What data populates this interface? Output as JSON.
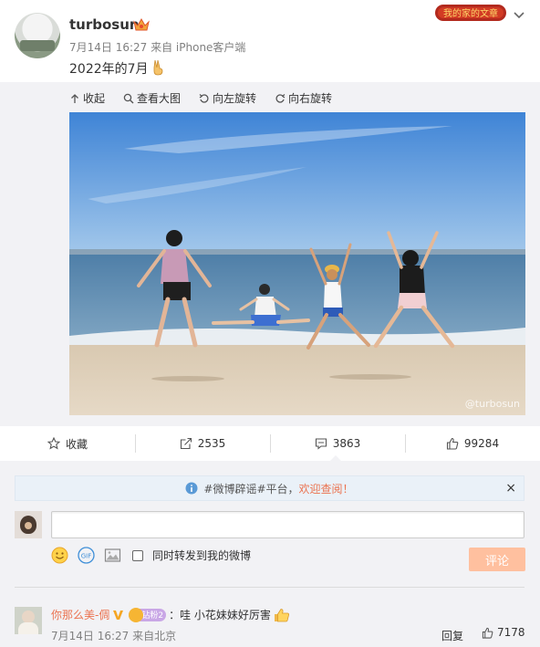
{
  "post": {
    "username": "turbosun",
    "meta": "7月14日 16:27 来自 iPhone客户端",
    "text": "2022年的7月",
    "badge_text": "我的家的文章"
  },
  "media_toolbar": {
    "collapse": "收起",
    "view_large": "查看大图",
    "rotate_left": "向左旋转",
    "rotate_right": "向右旋转"
  },
  "photo": {
    "watermark": "@turbosun"
  },
  "actions": {
    "favorite": "收藏",
    "repost_count": "2535",
    "comment_count": "3863",
    "like_count": "99284"
  },
  "notice": {
    "prefix": "#微博辟谣#平台，",
    "link": "欢迎查阅！",
    "close": "×"
  },
  "composer": {
    "repost_label": "同时转发到我的微博",
    "submit": "评论"
  },
  "comment": {
    "user": "你那么美-倜",
    "vip_level": "钻粉2",
    "text": "：哇 小花妹妹好厉害",
    "meta": "7月14日 16:27 来自北京",
    "reply": "回复",
    "likes": "7178"
  },
  "colors": {
    "accent": "#eb7350",
    "panel_bg": "#f2f2f5",
    "submit_disabled": "#ffc09f"
  }
}
